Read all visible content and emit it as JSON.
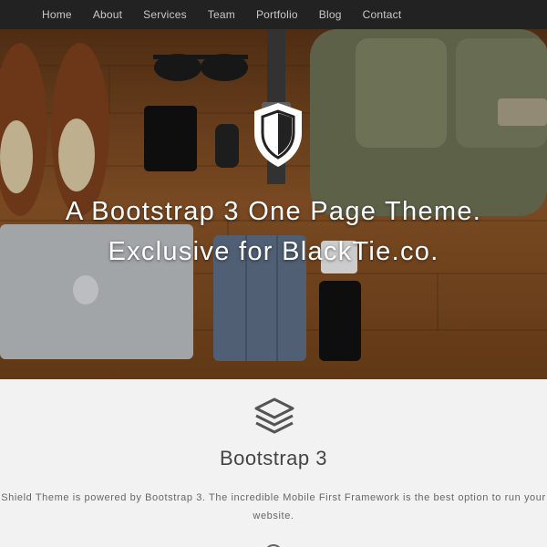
{
  "nav": {
    "items": [
      "Home",
      "About",
      "Services",
      "Team",
      "Portfolio",
      "Blog",
      "Contact"
    ]
  },
  "hero": {
    "line1": "A Bootstrap 3 One Page Theme.",
    "line2": "Exclusive for BlackTie.co."
  },
  "feature": {
    "title": "Bootstrap 3",
    "description": "Shield Theme is powered by Bootstrap 3. The incredible Mobile First Framework is the best option to run your website."
  },
  "colors": {
    "navbar": "#222222",
    "nav_text": "#c9c9c9",
    "section_bg": "#f2f2f2",
    "wood": "#7a4a22"
  },
  "icons": {
    "hero_logo": "shield-icon",
    "feature": "layers-icon"
  }
}
